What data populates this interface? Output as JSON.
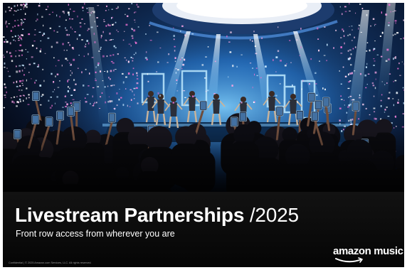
{
  "slide": {
    "title_main": "Livestream Partnerships",
    "title_year": "/2025",
    "subtitle": "Front row access from wherever you are",
    "footer_text": "Confidential | © 2025 Amazon.com Services, LLC. All rights reserved.",
    "logo_text": "amazon music"
  },
  "photo": {
    "subject": "concert stage with performers, confetti and crowd",
    "colors": {
      "stage_blue": "#2a7fd8",
      "confetti_pink": "#f28ad8",
      "crowd": "#0b0b12"
    }
  },
  "colors": {
    "band_bg": "#0a0a0a",
    "text": "#ffffff",
    "footer_text": "#9a9a9a"
  },
  "icons": [
    "amazon-smile-icon"
  ]
}
